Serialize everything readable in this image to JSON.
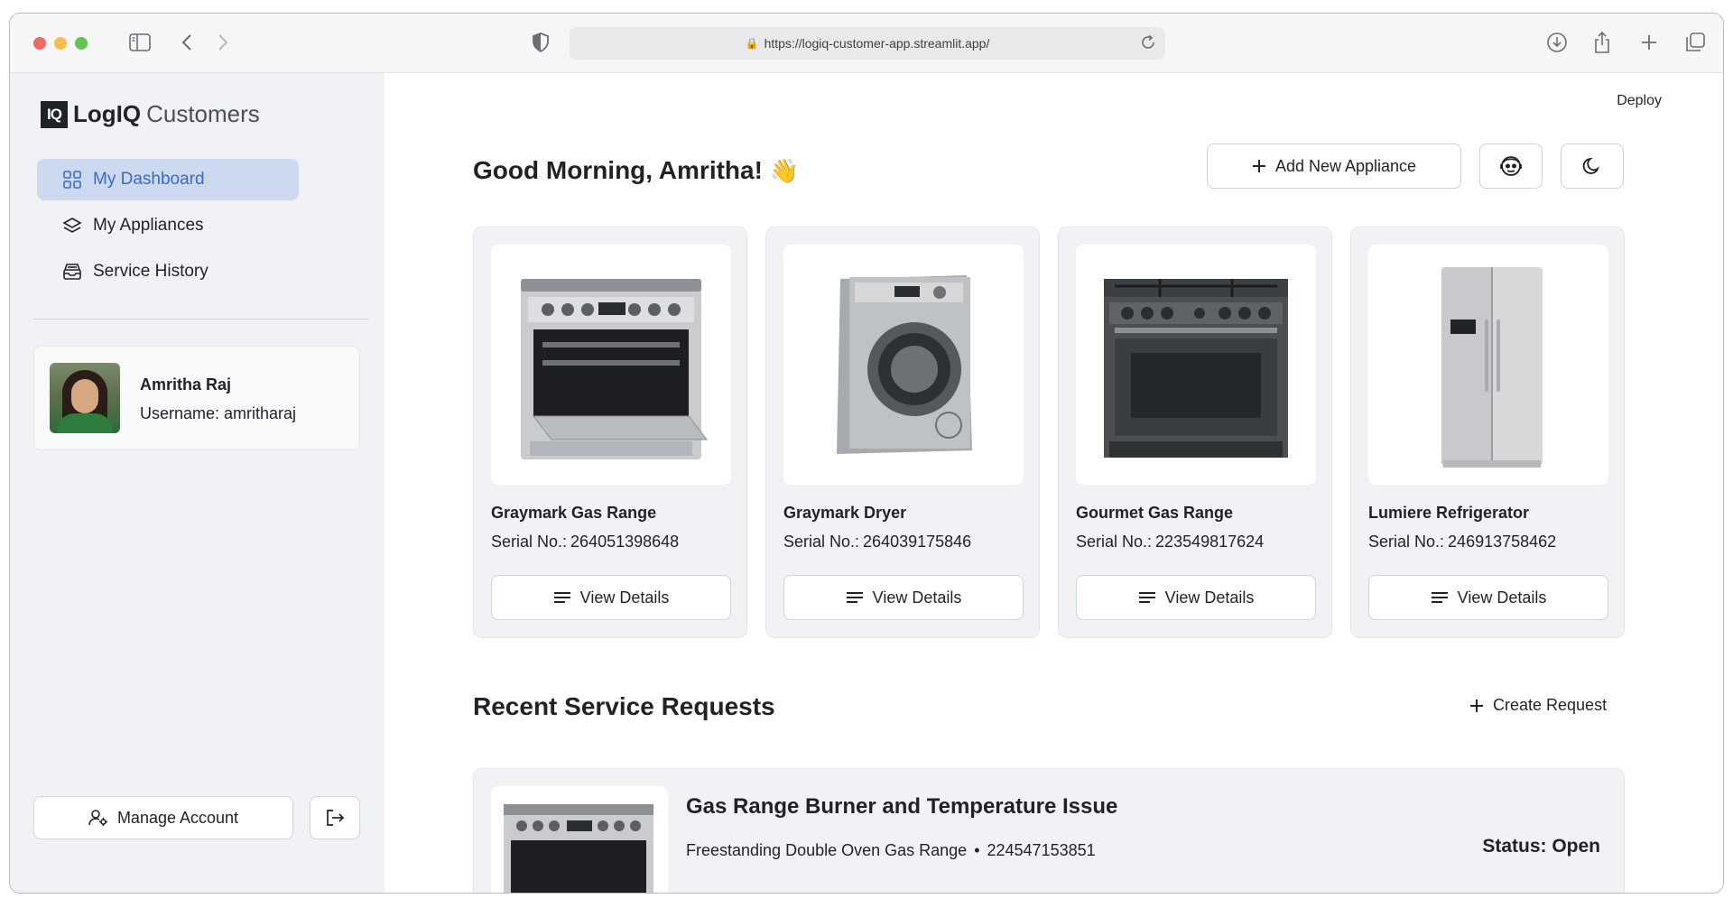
{
  "browser": {
    "url": "https://logiq-customer-app.streamlit.app/"
  },
  "brand": {
    "logo_mark": "IQ",
    "name_bold": "LogIQ",
    "name_light": "Customers"
  },
  "sidebar": {
    "items": [
      {
        "label": "My Dashboard",
        "icon": "grid-icon",
        "active": true
      },
      {
        "label": "My Appliances",
        "icon": "layers-icon",
        "active": false
      },
      {
        "label": "Service History",
        "icon": "inbox-icon",
        "active": false
      }
    ],
    "profile": {
      "name": "Amritha Raj",
      "username": "Username: amritharaj"
    },
    "manage_account_label": "Manage Account"
  },
  "header": {
    "deploy_label": "Deploy"
  },
  "main": {
    "greeting": "Good Morning, Amritha!",
    "greeting_emoji": "👋",
    "add_appliance_label": "Add New Appliance",
    "appliances": [
      {
        "name": "Graymark Gas Range",
        "serial_label": "Serial No.:",
        "serial": "264051398648",
        "view_label": "View Details",
        "image": "gas-range-stainless"
      },
      {
        "name": "Graymark Dryer",
        "serial_label": "Serial No.:",
        "serial": "264039175846",
        "view_label": "View Details",
        "image": "dryer"
      },
      {
        "name": "Gourmet Gas Range",
        "serial_label": "Serial No.:",
        "serial": "223549817624",
        "view_label": "View Details",
        "image": "gas-range-dark"
      },
      {
        "name": "Lumiere Refrigerator",
        "serial_label": "Serial No.:",
        "serial": "246913758462",
        "view_label": "View Details",
        "image": "refrigerator"
      }
    ],
    "recent_requests_title": "Recent Service Requests",
    "create_request_label": "Create Request",
    "requests": [
      {
        "title": "Gas Range Burner and Temperature Issue",
        "appliance": "Freestanding Double Oven Gas Range",
        "serial": "224547153851",
        "status": "Status: Open"
      }
    ]
  },
  "colors": {
    "accent": "#3a6ad1",
    "active_bg": "#cdd9ef",
    "sidebar_bg": "#f0f2f6"
  }
}
